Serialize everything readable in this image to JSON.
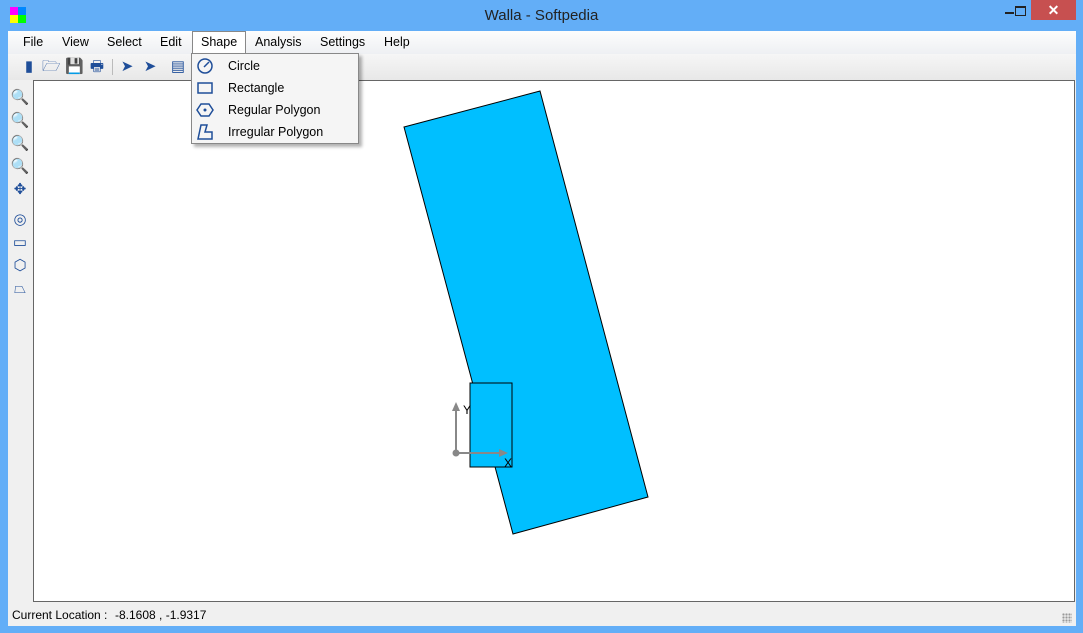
{
  "window": {
    "title": "Walla - Softpedia",
    "close_glyph": "✕"
  },
  "menubar": {
    "items": [
      "File",
      "View",
      "Select",
      "Edit",
      "Shape",
      "Analysis",
      "Settings",
      "Help"
    ],
    "open": "Shape"
  },
  "shape_menu": {
    "items": [
      {
        "label": "Circle",
        "icon": "circle-icon"
      },
      {
        "label": "Rectangle",
        "icon": "rectangle-icon"
      },
      {
        "label": "Regular Polygon",
        "icon": "regular-polygon-icon"
      },
      {
        "label": "Irregular Polygon",
        "icon": "irregular-polygon-icon"
      }
    ]
  },
  "toolbar": {
    "icons": [
      "new-icon",
      "open-icon",
      "save-icon",
      "print-icon",
      "select-icon",
      "select-node-icon",
      "calculator-icon"
    ]
  },
  "left_toolbar": {
    "icons": [
      "zoom-all-icon",
      "zoom-in-icon",
      "zoom-out-icon",
      "zoom-window-icon",
      "pan-icon",
      "circle-icon",
      "rectangle-icon",
      "regular-polygon-icon",
      "irregular-polygon-icon"
    ]
  },
  "canvas": {
    "shape_fill": "#00bfff",
    "axis_x_label": "X",
    "axis_y_label": "Y"
  },
  "status": {
    "label": "Current Location :",
    "value": "-8.1608 , -1.9317"
  },
  "colors": {
    "frame": "#63aef7",
    "close": "#c75050",
    "icon": "#1f4e99"
  }
}
